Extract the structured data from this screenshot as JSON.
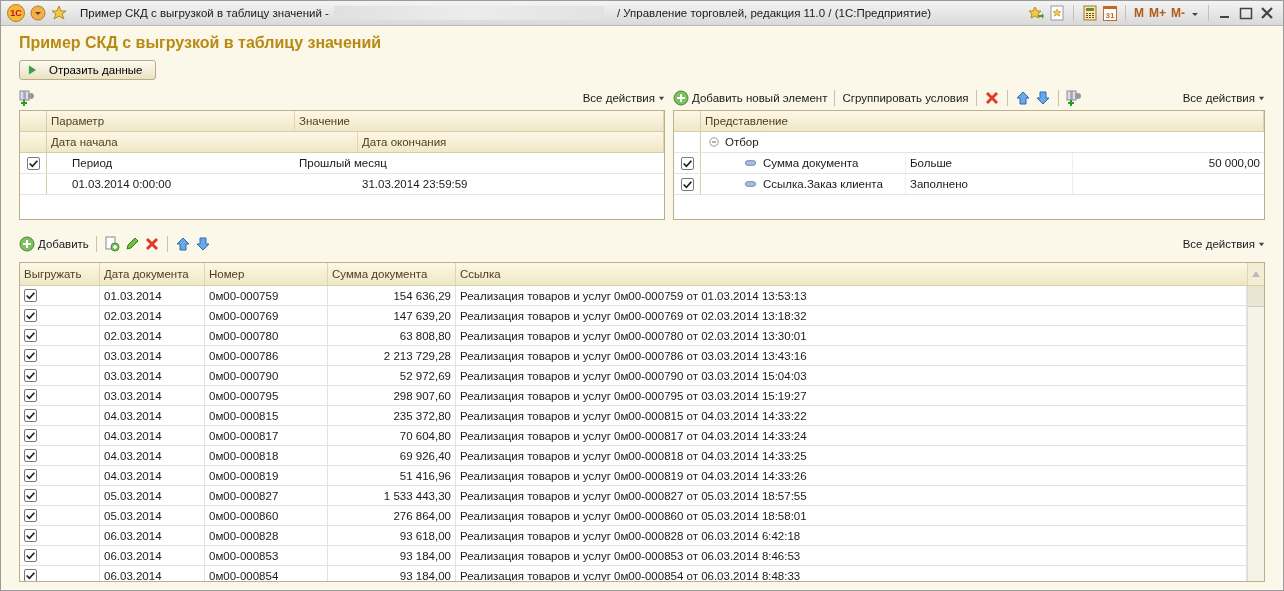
{
  "titlebar": {
    "logo": "1С",
    "title": "Пример СКД с выгрузкой в таблицу значений -",
    "app_title": "/ Управление торговлей, редакция 11.0 /  (1С:Предприятие)",
    "calendar_day": "31",
    "memory_buttons": [
      "M",
      "M+",
      "M-"
    ]
  },
  "heading": "Пример СКД с выгрузкой в таблицу значений",
  "run_button": "Отразить данные",
  "left_panel": {
    "actions": "Все действия",
    "header_row1": [
      "Параметр",
      "Значение"
    ],
    "header_row2": [
      "Дата начала",
      "Дата окончания"
    ],
    "rows": [
      {
        "checked": true,
        "parameter": "Период",
        "value": "Прошлый месяц",
        "start": "01.03.2014 0:00:00",
        "end": "31.03.2014 23:59:59"
      }
    ]
  },
  "right_panel": {
    "add": "Добавить новый элемент",
    "group_conditions": "Сгруппировать условия",
    "actions": "Все действия",
    "column": "Представление",
    "group": {
      "label": "Отбор",
      "expanded": true,
      "children": [
        {
          "checked": true,
          "field": "Сумма документа",
          "condition": "Больше",
          "value": "50 000,00"
        },
        {
          "checked": true,
          "field": "Ссылка.Заказ клиента",
          "condition": "Заполнено"
        }
      ]
    }
  },
  "table": {
    "add": "Добавить",
    "actions": "Все действия",
    "columns": [
      "Выгружать",
      "Дата документа",
      "Номер",
      "Сумма документа",
      "Ссылка"
    ],
    "rows": [
      {
        "export": true,
        "date": "01.03.2014",
        "number": "0м00-000759",
        "sum": "154 636,29",
        "ref": "Реализация товаров и услуг 0м00-000759 от 01.03.2014 13:53:13"
      },
      {
        "export": true,
        "date": "02.03.2014",
        "number": "0м00-000769",
        "sum": "147 639,20",
        "ref": "Реализация товаров и услуг 0м00-000769 от 02.03.2014 13:18:32"
      },
      {
        "export": true,
        "date": "02.03.2014",
        "number": "0м00-000780",
        "sum": "63 808,80",
        "ref": "Реализация товаров и услуг 0м00-000780 от 02.03.2014 13:30:01"
      },
      {
        "export": true,
        "date": "03.03.2014",
        "number": "0м00-000786",
        "sum": "2 213 729,28",
        "ref": "Реализация товаров и услуг 0м00-000786 от 03.03.2014 13:43:16"
      },
      {
        "export": true,
        "date": "03.03.2014",
        "number": "0м00-000790",
        "sum": "52 972,69",
        "ref": "Реализация товаров и услуг 0м00-000790 от 03.03.2014 15:04:03"
      },
      {
        "export": true,
        "date": "03.03.2014",
        "number": "0м00-000795",
        "sum": "298 907,60",
        "ref": "Реализация товаров и услуг 0м00-000795 от 03.03.2014 15:19:27"
      },
      {
        "export": true,
        "date": "04.03.2014",
        "number": "0м00-000815",
        "sum": "235 372,80",
        "ref": "Реализация товаров и услуг 0м00-000815 от 04.03.2014 14:33:22"
      },
      {
        "export": true,
        "date": "04.03.2014",
        "number": "0м00-000817",
        "sum": "70 604,80",
        "ref": "Реализация товаров и услуг 0м00-000817 от 04.03.2014 14:33:24"
      },
      {
        "export": true,
        "date": "04.03.2014",
        "number": "0м00-000818",
        "sum": "69 926,40",
        "ref": "Реализация товаров и услуг 0м00-000818 от 04.03.2014 14:33:25"
      },
      {
        "export": true,
        "date": "04.03.2014",
        "number": "0м00-000819",
        "sum": "51 416,96",
        "ref": "Реализация товаров и услуг 0м00-000819 от 04.03.2014 14:33:26"
      },
      {
        "export": true,
        "date": "05.03.2014",
        "number": "0м00-000827",
        "sum": "1 533 443,30",
        "ref": "Реализация товаров и услуг 0м00-000827 от 05.03.2014 18:57:55"
      },
      {
        "export": true,
        "date": "05.03.2014",
        "number": "0м00-000860",
        "sum": "276 864,00",
        "ref": "Реализация товаров и услуг 0м00-000860 от 05.03.2014 18:58:01"
      },
      {
        "export": true,
        "date": "06.03.2014",
        "number": "0м00-000828",
        "sum": "93 618,00",
        "ref": "Реализация товаров и услуг 0м00-000828 от 06.03.2014 6:42:18"
      },
      {
        "export": true,
        "date": "06.03.2014",
        "number": "0м00-000853",
        "sum": "93 184,00",
        "ref": "Реализация товаров и услуг 0м00-000853 от 06.03.2014 8:46:53"
      },
      {
        "export": true,
        "date": "06.03.2014",
        "number": "0м00-000854",
        "sum": "93 184,00",
        "ref": "Реализация товаров и услуг 0м00-000854 от 06.03.2014 8:48:33"
      }
    ]
  }
}
